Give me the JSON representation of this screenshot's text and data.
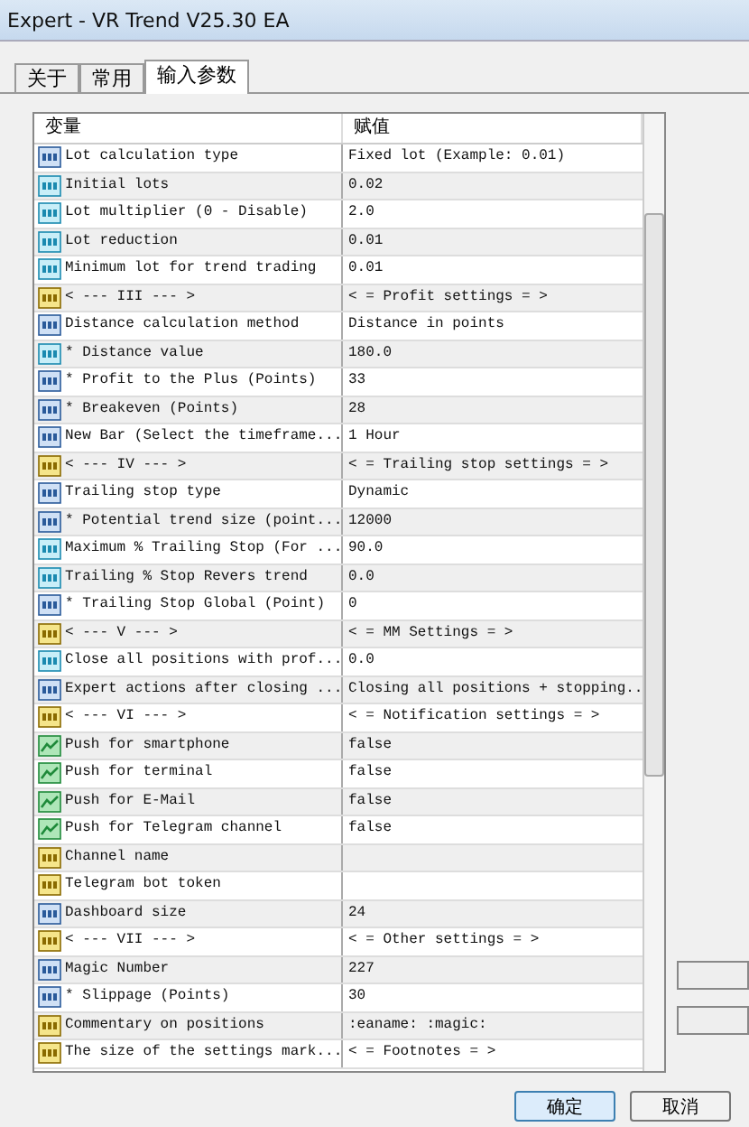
{
  "window": {
    "title": "Expert - VR Trend V25.30 EA"
  },
  "tabs": [
    {
      "label": "关于",
      "selected": false
    },
    {
      "label": "常用",
      "selected": false
    },
    {
      "label": "输入参数",
      "selected": true
    }
  ],
  "table": {
    "columns": [
      "变量",
      "赋值"
    ],
    "rows": [
      {
        "kind": "enum",
        "name": "Lot calculation type",
        "value": "Fixed lot (Example: 0.01)"
      },
      {
        "kind": "double",
        "name": "Initial lots",
        "value": "0.02"
      },
      {
        "kind": "double",
        "name": "Lot multiplier (0 - Disable)",
        "value": "2.0"
      },
      {
        "kind": "double",
        "name": "Lot reduction",
        "value": "0.01"
      },
      {
        "kind": "double",
        "name": "Minimum lot for trend trading",
        "value": "0.01"
      },
      {
        "kind": "string",
        "name": "< --- III --- >",
        "value": "< = Profit settings = >"
      },
      {
        "kind": "enum",
        "name": "Distance calculation method",
        "value": "Distance in points"
      },
      {
        "kind": "double",
        "name": "* Distance value",
        "value": "180.0"
      },
      {
        "kind": "enum",
        "name": "* Profit to the Plus (Points)",
        "value": "33"
      },
      {
        "kind": "enum",
        "name": "* Breakeven (Points)",
        "value": "28"
      },
      {
        "kind": "enum",
        "name": "New Bar (Select the timeframe...",
        "value": "1 Hour"
      },
      {
        "kind": "string",
        "name": "< --- IV --- >",
        "value": "< = Trailing stop settings = >"
      },
      {
        "kind": "enum",
        "name": "Trailing stop type",
        "value": "Dynamic"
      },
      {
        "kind": "enum",
        "name": "* Potential trend size (point...",
        "value": "12000"
      },
      {
        "kind": "double",
        "name": "Maximum % Trailing Stop (For ...",
        "value": "90.0"
      },
      {
        "kind": "double",
        "name": "Trailing % Stop Revers trend",
        "value": "0.0"
      },
      {
        "kind": "enum",
        "name": "* Trailing Stop Global (Point)",
        "value": "0"
      },
      {
        "kind": "string",
        "name": "< --- V --- >",
        "value": "< = MM Settings = >"
      },
      {
        "kind": "double",
        "name": "Close all positions with prof...",
        "value": "0.0"
      },
      {
        "kind": "enum",
        "name": "Expert actions after closing ...",
        "value": "Closing all positions + stopping.."
      },
      {
        "kind": "string",
        "name": "< --- VI --- >",
        "value": "< = Notification settings = >"
      },
      {
        "kind": "bool",
        "name": "Push for smartphone",
        "value": "false"
      },
      {
        "kind": "bool",
        "name": "Push for terminal",
        "value": "false"
      },
      {
        "kind": "bool",
        "name": "Push for E-Mail",
        "value": "false"
      },
      {
        "kind": "bool",
        "name": "Push for Telegram channel",
        "value": "false"
      },
      {
        "kind": "string",
        "name": "Channel name"
      },
      {
        "kind": "string",
        "name": "Telegram bot token"
      },
      {
        "kind": "enum",
        "name": "Dashboard size",
        "value": "24"
      },
      {
        "kind": "string",
        "name": "< --- VII --- >",
        "value": "< = Other settings = >"
      },
      {
        "kind": "enum",
        "name": "Magic Number",
        "value": "227"
      },
      {
        "kind": "enum",
        "name": "* Slippage (Points)",
        "value": "30"
      },
      {
        "kind": "string",
        "name": "Commentary on positions",
        "value": ":eaname: :magic:"
      },
      {
        "kind": "string",
        "name": "The size of the settings mark...",
        "value": "< = Footnotes = >"
      }
    ]
  },
  "buttons": [
    "确定",
    "取消"
  ]
}
